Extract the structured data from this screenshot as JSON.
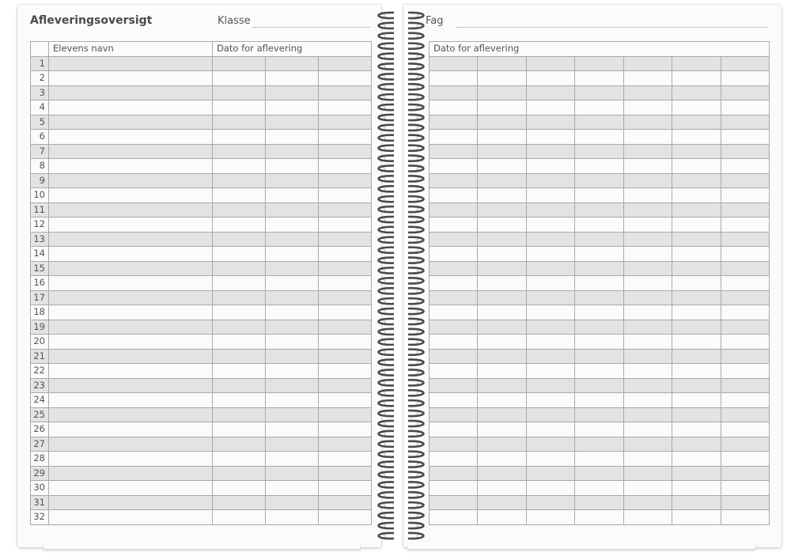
{
  "left_page": {
    "title": "Afleveringsoversigt",
    "class_label": "Klasse",
    "headers": {
      "student_name": "Elevens navn",
      "delivery_date": "Dato for aflevering"
    },
    "row_numbers": [
      "1",
      "2",
      "3",
      "4",
      "5",
      "6",
      "7",
      "8",
      "9",
      "10",
      "11",
      "12",
      "13",
      "14",
      "15",
      "16",
      "17",
      "18",
      "19",
      "20",
      "21",
      "22",
      "23",
      "24",
      "25",
      "26",
      "27",
      "28",
      "29",
      "30",
      "31",
      "32"
    ]
  },
  "right_page": {
    "subject_label": "Fag",
    "headers": {
      "delivery_date": "Dato for aflevering"
    }
  },
  "colors": {
    "page": "#fbfbf9",
    "row_shade": "#e3e3e5",
    "grid_line": "#a9a9a9",
    "spiral": "#4a4a4a"
  }
}
